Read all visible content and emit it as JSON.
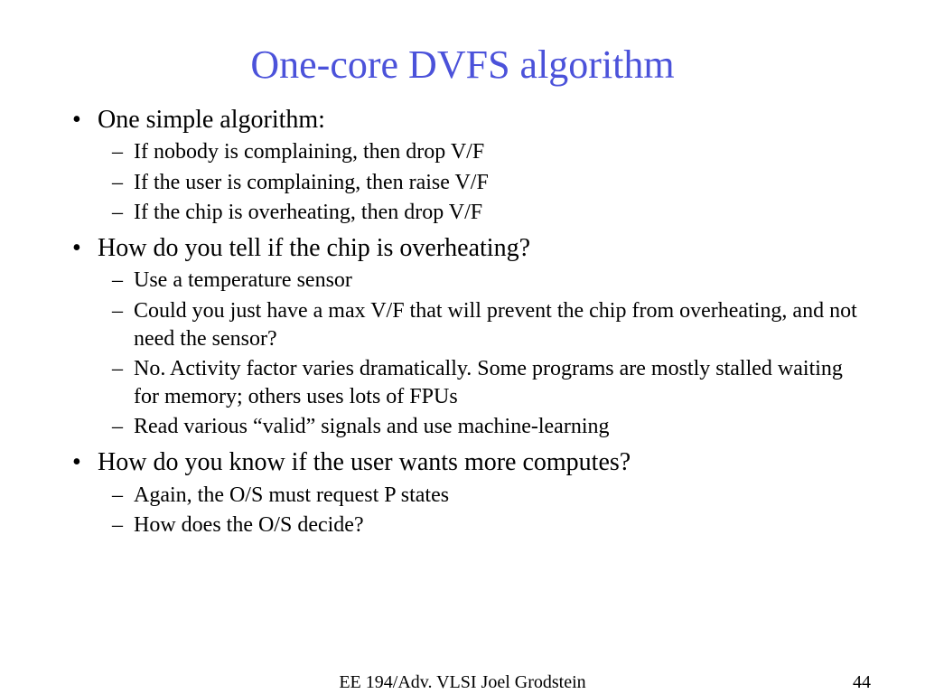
{
  "title": "One-core DVFS algorithm",
  "b1": "One simple algorithm:",
  "b1s1": "If nobody is complaining, then drop V/F",
  "b1s2": "If the user is complaining, then raise V/F",
  "b1s3": "If the chip is overheating, then drop V/F",
  "b2": "How do you tell if the chip is overheating?",
  "b2s1": "Use a temperature sensor",
  "b2s2": "Could  you just have a max V/F that will prevent the chip from overheating, and not need the sensor?",
  "b2s3": "No. Activity factor varies dramatically. Some programs are mostly stalled waiting for memory; others uses lots of FPUs",
  "b2s4": "Read various “valid” signals and use machine-learning",
  "b3": "How do you know if the user wants more computes?",
  "b3s1": "Again, the O/S must request P states",
  "b3s2": "How does the O/S decide?",
  "footer_center": "EE 194/Adv. VLSI Joel Grodstein",
  "footer_right": "44"
}
